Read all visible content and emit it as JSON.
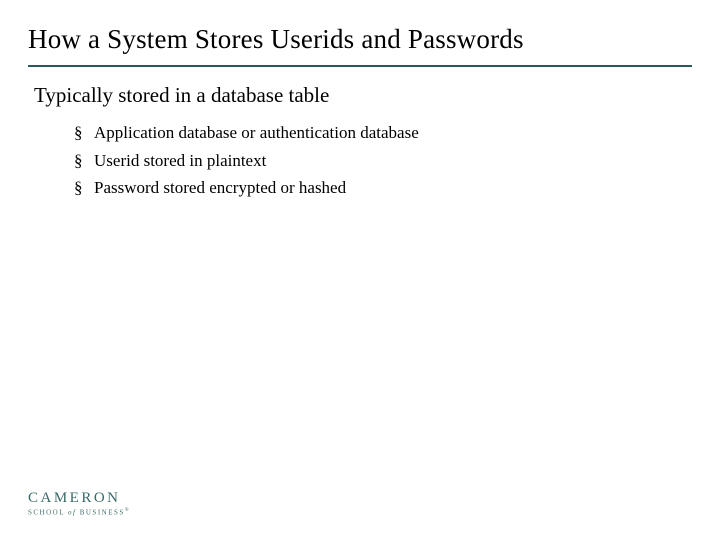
{
  "slide": {
    "title": "How a System Stores Userids and Passwords",
    "main_point": "Typically stored in a database table",
    "bullets": [
      "Application database or authentication database",
      "Userid stored in plaintext",
      "Password stored encrypted or hashed"
    ]
  },
  "logo": {
    "main": "CAMERON",
    "sub": "SCHOOL of BUSINESS"
  }
}
